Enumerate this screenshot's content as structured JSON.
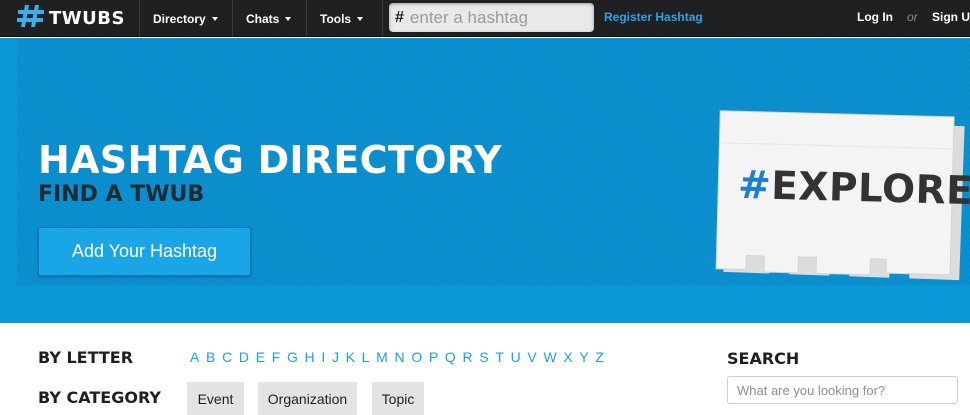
{
  "nav": {
    "logo_text": "TWUBS",
    "logo_icon": "hashtag-icon",
    "menu": [
      {
        "label": "Directory"
      },
      {
        "label": "Chats"
      },
      {
        "label": "Tools"
      }
    ],
    "search": {
      "prefix": "#",
      "placeholder": "enter a hashtag",
      "value": ""
    },
    "register_label": "Register Hashtag",
    "login_label": "Log In",
    "or_label": "or",
    "signup_label": "Sign U",
    "colors": {
      "bar": "#1e2022",
      "link_accent": "#2aa4e2"
    }
  },
  "hero": {
    "title": "HASHTAG DIRECTORY",
    "subtitle": "FIND A TWUB",
    "button_label": "Add Your Hashtag",
    "card_hash": "#",
    "card_word": "EXPLORE",
    "colors": {
      "background": "#0a8dcc",
      "button": "#1aa6e6",
      "card_hash": "#1d7fd0"
    }
  },
  "browse": {
    "by_letter_label": "BY LETTER",
    "letters": [
      "A",
      "B",
      "C",
      "D",
      "E",
      "F",
      "G",
      "H",
      "I",
      "J",
      "K",
      "L",
      "M",
      "N",
      "O",
      "P",
      "Q",
      "R",
      "S",
      "T",
      "U",
      "V",
      "W",
      "X",
      "Y",
      "Z"
    ],
    "by_category_label": "BY CATEGORY",
    "categories": [
      {
        "label": "Event"
      },
      {
        "label": "Organization"
      },
      {
        "label": "Topic"
      }
    ]
  },
  "sidebar_search": {
    "label": "SEARCH",
    "placeholder": "What are you looking for?",
    "value": ""
  }
}
